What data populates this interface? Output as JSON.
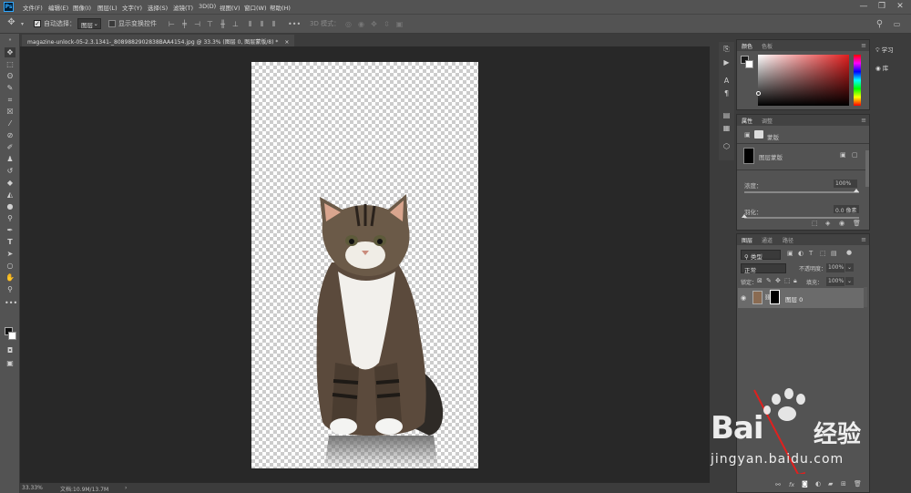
{
  "app": {
    "logo": "Ps"
  },
  "menu": [
    "文件(F)",
    "编辑(E)",
    "图像(I)",
    "图层(L)",
    "文字(Y)",
    "选择(S)",
    "滤镜(T)",
    "3D(D)",
    "视图(V)",
    "窗口(W)",
    "帮助(H)"
  ],
  "window_controls": [
    "—",
    "❐",
    "✕"
  ],
  "options": {
    "auto_select_label": "自动选择：",
    "auto_select_value": "图层",
    "show_transform_label": "显示变换控件",
    "mode_3d_label": "3D 模式："
  },
  "document": {
    "tab_title": "magazine-unlock-05-2.3.1341-_8089882902838BAA4154.jpg @ 33.3% (图层 0, 图层蒙版/8) *",
    "close": "×"
  },
  "status": {
    "zoom": "33.33%",
    "doc_size": "文档:10.9M/13.7M",
    "arrow": "›"
  },
  "learn_panel": {
    "learn": "学习",
    "library": "库"
  },
  "color_panel": {
    "tabs": [
      "颜色",
      "色板"
    ]
  },
  "properties_panel": {
    "tabs": [
      "属性",
      "调整"
    ],
    "mask_label": "蒙版",
    "layer_mask_label": "图层蒙版",
    "density_label": "浓度：",
    "density_value": "100%",
    "feather_label": "羽化：",
    "feather_value": "0.0 像素"
  },
  "layers_panel": {
    "tabs": [
      "图层",
      "通道",
      "路径"
    ],
    "filter_kind": "类型",
    "blend_mode": "正常",
    "opacity_label": "不透明度：",
    "opacity_value": "100%",
    "lock_label": "锁定：",
    "fill_label": "填充：",
    "fill_value": "100%",
    "layer_name": "图层 0",
    "footer_fx": "fx"
  },
  "watermark": {
    "brand": "Bai",
    "brand2": "经验",
    "url": "jingyan.baidu.com"
  }
}
